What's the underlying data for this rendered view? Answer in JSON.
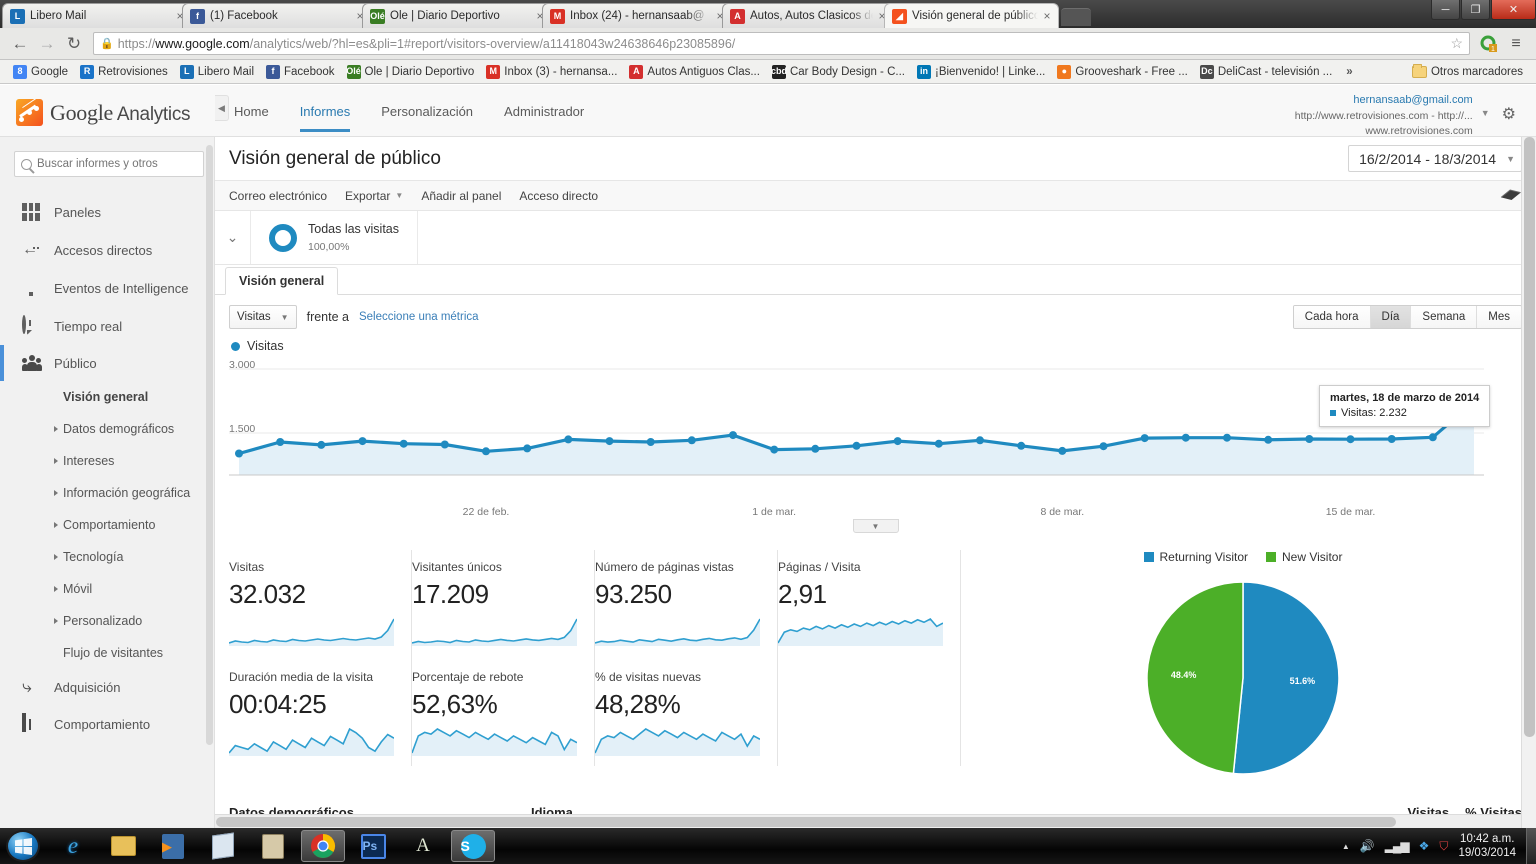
{
  "browser": {
    "tabs": [
      {
        "label": "Libero Mail",
        "favicon_text": "L",
        "favicon_color": "#1a6fb5",
        "active": false,
        "close": "×"
      },
      {
        "label": "(1) Facebook",
        "favicon_text": "f",
        "favicon_color": "#3b5998",
        "active": false,
        "close": "×"
      },
      {
        "label": "Ole | Diario Deportivo",
        "favicon_text": "Olé",
        "favicon_color": "#3a7d23",
        "active": false,
        "close": "×"
      },
      {
        "label": "Inbox (24) - hernansaab@",
        "favicon_text": "M",
        "favicon_color": "#d93025",
        "active": false,
        "close": "×"
      },
      {
        "label": "Autos, Autos Clasicos de C",
        "favicon_text": "A",
        "favicon_color": "#d32f2f",
        "active": false,
        "close": "×"
      },
      {
        "label": "Visión general de público",
        "favicon_text": "◢",
        "favicon_color": "#f4511e",
        "active": true,
        "close": "×"
      }
    ],
    "window_buttons": {
      "minimize": "─",
      "maximize": "❐",
      "close": "✕"
    },
    "nav": {
      "back": "←",
      "forward": "→",
      "reload": "↻"
    },
    "url": {
      "lock": "🔒",
      "scheme": "https://",
      "domain": "www.google.com",
      "path": "/analytics/web/?hl=es&pli=1#report/visitors-overview/a11418043w24638646p23085896/",
      "star": "☆"
    },
    "omni_extra": {
      "extension_badge": "1",
      "menu": "≡"
    },
    "bookmarks": [
      {
        "label": "Google",
        "fav_text": "8",
        "fav_color": "#4285f4"
      },
      {
        "label": "Retrovisiones",
        "fav_text": "R",
        "fav_color": "#1a73c8"
      },
      {
        "label": "Libero Mail",
        "fav_text": "L",
        "fav_color": "#1a6fb5"
      },
      {
        "label": "Facebook",
        "fav_text": "f",
        "fav_color": "#3b5998"
      },
      {
        "label": "Ole | Diario Deportivo",
        "fav_text": "Olé",
        "fav_color": "#3a7d23"
      },
      {
        "label": "Inbox (3) - hernansa...",
        "fav_text": "M",
        "fav_color": "#d93025"
      },
      {
        "label": "Autos Antiguos Clas...",
        "fav_text": "A",
        "fav_color": "#d32f2f"
      },
      {
        "label": "Car Body Design - C...",
        "fav_text": "cbd",
        "fav_color": "#222222"
      },
      {
        "label": "¡Bienvenido! | Linke...",
        "fav_text": "in",
        "fav_color": "#0077b5"
      },
      {
        "label": "Grooveshark - Free ...",
        "fav_text": "●",
        "fav_color": "#f0781e"
      },
      {
        "label": "DeliCast - televisión ...",
        "fav_text": "Dc",
        "fav_color": "#4a4a4a"
      }
    ],
    "bookmarks_overflow": "»",
    "bookmarks_folder": "Otros marcadores"
  },
  "ga_header": {
    "logo_brand": "Google",
    "logo_product": "Analytics",
    "nav": [
      {
        "label": "Home",
        "active": false
      },
      {
        "label": "Informes",
        "active": true
      },
      {
        "label": "Personalización",
        "active": false
      },
      {
        "label": "Administrador",
        "active": false
      }
    ],
    "account_email": "hernansaab@gmail.com",
    "account_line2": "http://www.retrovisiones.com - http://...",
    "account_line3": "www.retrovisiones.com",
    "account_caret": "▼",
    "gear_icon": "⚙"
  },
  "sidebar": {
    "search_placeholder": "Buscar informes y otros",
    "items": [
      {
        "label": "Paneles",
        "icon": "panels-icon"
      },
      {
        "label": "Accesos directos",
        "icon": "shortcut-arrow-icon"
      },
      {
        "label": "Eventos de Intelligence",
        "icon": "bulb-icon"
      },
      {
        "label": "Tiempo real",
        "icon": "clock-icon"
      },
      {
        "label": "Público",
        "icon": "people-icon",
        "selected": true
      },
      {
        "label": "Adquisición",
        "icon": "acquisition-icon"
      },
      {
        "label": "Comportamiento",
        "icon": "behavior-icon"
      }
    ],
    "audience_sub": [
      {
        "label": "Visión general",
        "bold": true,
        "caret": false
      },
      {
        "label": "Datos demográficos",
        "bold": false,
        "caret": true
      },
      {
        "label": "Intereses",
        "bold": false,
        "caret": true
      },
      {
        "label": "Información geográfica",
        "bold": false,
        "caret": true
      },
      {
        "label": "Comportamiento",
        "bold": false,
        "caret": true
      },
      {
        "label": "Tecnología",
        "bold": false,
        "caret": true
      },
      {
        "label": "Móvil",
        "bold": false,
        "caret": true
      },
      {
        "label": "Personalizado",
        "bold": false,
        "caret": true
      },
      {
        "label": "Flujo de visitantes",
        "bold": false,
        "caret": false
      }
    ],
    "collapse_icon": "◀"
  },
  "report": {
    "title": "Visión general de público",
    "date_range": "16/2/2014 - 18/3/2014",
    "date_caret": "▼",
    "actions": [
      {
        "label": "Correo electrónico",
        "caret": false
      },
      {
        "label": "Exportar",
        "caret": true
      },
      {
        "label": "Añadir al panel",
        "caret": false
      },
      {
        "label": "Acceso directo",
        "caret": false
      }
    ],
    "share_icon": "share-icon",
    "segment": {
      "toggle_icon": "⌄",
      "name": "Todas las visitas",
      "percent": "100,00%"
    },
    "tab_label": "Visión general",
    "metric_select": "Visitas",
    "metric_caret": "▼",
    "compare_label": "frente a",
    "select_metric_link": "Seleccione una métrica",
    "granularity": [
      {
        "label": "Cada hora",
        "on": false
      },
      {
        "label": "Día",
        "on": true
      },
      {
        "label": "Semana",
        "on": false
      },
      {
        "label": "Mes",
        "on": false
      }
    ],
    "chart_legend": "Visitas",
    "tooltip": {
      "date": "martes, 18 de marzo de 2014",
      "metric": "Visitas: 2.232"
    },
    "zoom_handle_icon": "▼",
    "cards_row1": [
      {
        "label": "Visitas",
        "value": "32.032"
      },
      {
        "label": "Visitantes únicos",
        "value": "17.209"
      },
      {
        "label": "Número de páginas vistas",
        "value": "93.250"
      },
      {
        "label": "Páginas / Visita",
        "value": "2,91"
      }
    ],
    "cards_row2": [
      {
        "label": "Duración media de la visita",
        "value": "00:04:25"
      },
      {
        "label": "Porcentaje de rebote",
        "value": "52,63%"
      },
      {
        "label": "% de visitas nuevas",
        "value": "48,28%"
      }
    ],
    "bottom": {
      "demographics": "Datos demográficos",
      "language": "Idioma",
      "visits": "Visitas",
      "pct_visits": "% Visitas"
    }
  },
  "chart_data": [
    {
      "type": "line",
      "title": "Visitas",
      "xlabel": "",
      "ylabel": "Visitas",
      "ylim": [
        0,
        3000
      ],
      "yticks": [
        1500,
        3000
      ],
      "ytick_labels": [
        "1.500",
        "3.000"
      ],
      "grid": true,
      "legend": "Visitas",
      "legend_position": "top-left",
      "x_tick_labels": [
        "22 de feb.",
        "1 de mar.",
        "8 de mar.",
        "15 de mar."
      ],
      "x_tick_indices": [
        6,
        13,
        20,
        27
      ],
      "x": [
        "16 feb",
        "17 feb",
        "18 feb",
        "19 feb",
        "20 feb",
        "21 feb",
        "22 feb",
        "23 feb",
        "24 feb",
        "25 feb",
        "26 feb",
        "27 feb",
        "28 feb",
        "1 mar",
        "2 mar",
        "3 mar",
        "4 mar",
        "5 mar",
        "6 mar",
        "7 mar",
        "8 mar",
        "9 mar",
        "10 mar",
        "11 mar",
        "12 mar",
        "13 mar",
        "14 mar",
        "15 mar",
        "16 mar",
        "17 mar",
        "18 mar"
      ],
      "values": [
        1020,
        1290,
        1220,
        1310,
        1250,
        1230,
        1070,
        1140,
        1350,
        1310,
        1290,
        1330,
        1450,
        1110,
        1130,
        1200,
        1310,
        1250,
        1330,
        1200,
        1080,
        1190,
        1380,
        1390,
        1390,
        1340,
        1360,
        1355,
        1360,
        1400,
        2232
      ],
      "color": "#1f8ac0",
      "fill_color": "#e3f0f8",
      "annotation": {
        "date": "martes, 18 de marzo de 2014",
        "series": "Visitas",
        "value": 2232,
        "value_text": "2.232"
      }
    },
    {
      "type": "pie",
      "title": "",
      "labels": [
        "Returning Visitor",
        "New Visitor"
      ],
      "values": [
        51.6,
        48.4
      ],
      "value_labels": [
        "51.6%",
        "48.4%"
      ],
      "colors": [
        "#1f8ac0",
        "#4caf28"
      ],
      "legend_position": "top"
    },
    {
      "type": "line",
      "title": "Visitas sparkline",
      "values": [
        30,
        34,
        32,
        31,
        35,
        33,
        32,
        36,
        34,
        33,
        37,
        35,
        34,
        36,
        38,
        36,
        35,
        37,
        39,
        37,
        36,
        38,
        40,
        38,
        42,
        55,
        78
      ],
      "color": "#2f9fd0"
    },
    {
      "type": "line",
      "title": "Visitantes únicos sparkline",
      "values": [
        30,
        33,
        31,
        32,
        34,
        33,
        31,
        35,
        33,
        32,
        36,
        34,
        33,
        35,
        37,
        35,
        34,
        36,
        38,
        36,
        35,
        37,
        39,
        37,
        41,
        54,
        77
      ],
      "color": "#2f9fd0"
    },
    {
      "type": "line",
      "title": "Número de páginas vistas sparkline",
      "values": [
        28,
        32,
        30,
        31,
        34,
        32,
        30,
        35,
        33,
        31,
        36,
        34,
        32,
        35,
        37,
        34,
        33,
        36,
        38,
        35,
        34,
        37,
        39,
        36,
        40,
        56,
        80
      ],
      "color": "#2f9fd0"
    },
    {
      "type": "line",
      "title": "Páginas / Visita sparkline",
      "values": [
        42,
        55,
        58,
        56,
        60,
        58,
        62,
        59,
        63,
        60,
        64,
        61,
        65,
        62,
        66,
        63,
        67,
        64,
        68,
        65,
        69,
        66,
        70,
        67,
        71,
        62,
        66
      ],
      "color": "#2f9fd0"
    },
    {
      "type": "line",
      "title": "Duración media de la visita sparkline",
      "values": [
        32,
        40,
        38,
        36,
        42,
        38,
        34,
        44,
        40,
        36,
        46,
        42,
        38,
        48,
        44,
        40,
        50,
        46,
        42,
        58,
        54,
        48,
        38,
        34,
        44,
        52,
        48
      ],
      "color": "#2f9fd0"
    },
    {
      "type": "line",
      "title": "Porcentaje de rebote sparkline",
      "values": [
        34,
        44,
        46,
        45,
        48,
        46,
        44,
        47,
        45,
        43,
        46,
        44,
        42,
        45,
        43,
        41,
        44,
        42,
        40,
        43,
        41,
        39,
        46,
        44,
        36,
        42,
        40
      ],
      "color": "#2f9fd0"
    },
    {
      "type": "line",
      "title": "% de visitas nuevas sparkline",
      "values": [
        34,
        42,
        44,
        43,
        46,
        44,
        42,
        45,
        48,
        46,
        44,
        47,
        45,
        43,
        46,
        44,
        42,
        45,
        43,
        41,
        46,
        44,
        42,
        45,
        38,
        44,
        42
      ],
      "color": "#2f9fd0"
    }
  ],
  "taskbar": {
    "start_icon": "⊞",
    "buttons": [
      {
        "name": "internet-explorer",
        "glyph": "e",
        "color": "#3ba3e0",
        "active": false
      },
      {
        "name": "file-explorer",
        "glyph": "🗁",
        "color": "#e8c05a",
        "active": false
      },
      {
        "name": "media-player",
        "glyph": "▶",
        "color": "#f07d1a",
        "active": false
      },
      {
        "name": "notepad",
        "glyph": "🗎",
        "color": "#cfd8e3",
        "active": false
      },
      {
        "name": "calculator",
        "glyph": "▤",
        "color": "#d6c9a8",
        "active": false
      },
      {
        "name": "google-chrome",
        "glyph": "●",
        "color": "#4caf50",
        "active": true
      },
      {
        "name": "photoshop",
        "glyph": "Ps",
        "color": "#2a6fd8",
        "active": false
      },
      {
        "name": "autocad",
        "glyph": "A",
        "color": "#9fb86a",
        "active": false
      },
      {
        "name": "skype",
        "glyph": "S",
        "color": "#2aafe8",
        "active": true
      }
    ],
    "tray": {
      "arrow": "▲",
      "volume": "🔊",
      "network": "▂▄▆",
      "dropbox": "❖",
      "antivirus": "⛉",
      "time": "10:42 a.m.",
      "date": "19/03/2014"
    }
  }
}
